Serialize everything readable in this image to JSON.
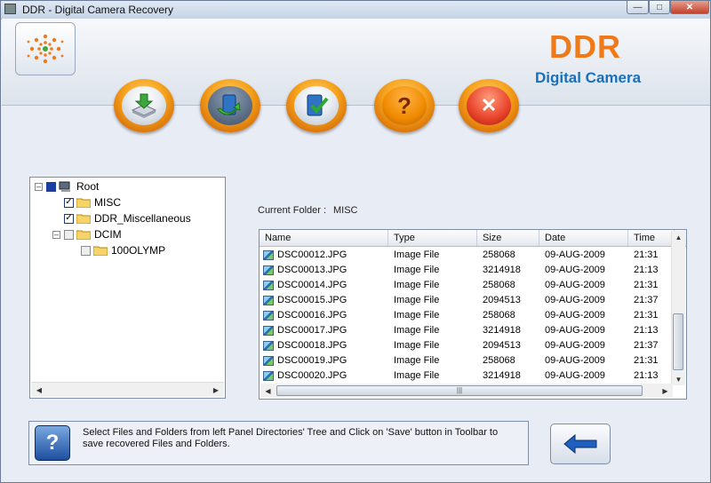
{
  "window": {
    "title": "DDR - Digital Camera Recovery"
  },
  "brand": {
    "name": "DDR",
    "product": "Digital Camera"
  },
  "toolbar": {
    "buttons": [
      {
        "name": "save-button",
        "icon": "save-disk-icon"
      },
      {
        "name": "open-button",
        "icon": "open-folder-icon"
      },
      {
        "name": "select-button",
        "icon": "checkmark-icon"
      },
      {
        "name": "help-button",
        "icon": "question-mark-icon"
      },
      {
        "name": "exit-button",
        "icon": "close-x-icon"
      }
    ]
  },
  "tree": {
    "nodes": [
      {
        "label": "Root",
        "checked": "partial"
      },
      {
        "label": "MISC",
        "checked": true
      },
      {
        "label": "DDR_Miscellaneous",
        "checked": true
      },
      {
        "label": "DCIM",
        "checked": false
      },
      {
        "label": "100OLYMP",
        "checked": false
      }
    ]
  },
  "current_folder": {
    "label": "Current Folder :",
    "value": "MISC"
  },
  "list": {
    "columns": [
      "Name",
      "Type",
      "Size",
      "Date",
      "Time"
    ],
    "rows": [
      [
        "DSC00012.JPG",
        "Image File",
        "258068",
        "09-AUG-2009",
        "21:31"
      ],
      [
        "DSC00013.JPG",
        "Image File",
        "3214918",
        "09-AUG-2009",
        "21:13"
      ],
      [
        "DSC00014.JPG",
        "Image File",
        "258068",
        "09-AUG-2009",
        "21:31"
      ],
      [
        "DSC00015.JPG",
        "Image File",
        "2094513",
        "09-AUG-2009",
        "21:37"
      ],
      [
        "DSC00016.JPG",
        "Image File",
        "258068",
        "09-AUG-2009",
        "21:31"
      ],
      [
        "DSC00017.JPG",
        "Image File",
        "3214918",
        "09-AUG-2009",
        "21:13"
      ],
      [
        "DSC00018.JPG",
        "Image File",
        "2094513",
        "09-AUG-2009",
        "21:37"
      ],
      [
        "DSC00019.JPG",
        "Image File",
        "258068",
        "09-AUG-2009",
        "21:31"
      ],
      [
        "DSC00020.JPG",
        "Image File",
        "3214918",
        "09-AUG-2009",
        "21:13"
      ]
    ]
  },
  "help": {
    "text": "Select Files and Folders from left Panel Directories' Tree and Click on 'Save' button in Toolbar to save recovered Files and Folders."
  },
  "colors": {
    "brand_orange": "#f07a18",
    "brand_blue": "#1a6fba"
  }
}
